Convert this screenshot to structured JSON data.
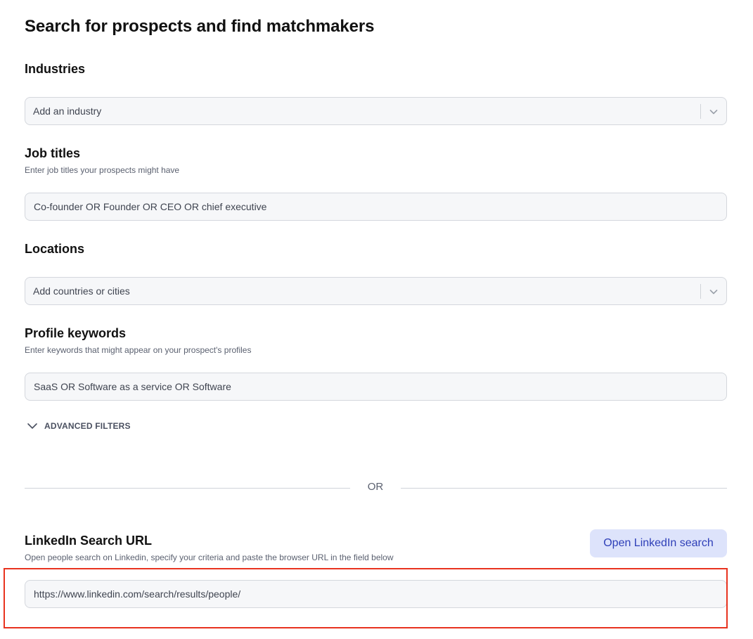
{
  "page": {
    "title": "Search for prospects and find matchmakers"
  },
  "industries": {
    "label": "Industries",
    "placeholder": "Add an industry"
  },
  "job_titles": {
    "label": "Job titles",
    "hint": "Enter job titles your prospects might have",
    "value": "Co-founder OR Founder OR CEO OR chief executive"
  },
  "locations": {
    "label": "Locations",
    "placeholder": "Add countries or cities"
  },
  "profile_keywords": {
    "label": "Profile keywords",
    "hint": "Enter keywords that might appear on your prospect's profiles",
    "value": "SaaS OR Software as a service OR Software"
  },
  "advanced_filters": {
    "label": "ADVANCED FILTERS"
  },
  "divider": {
    "label": "OR"
  },
  "linkedin": {
    "label": "LinkedIn Search URL",
    "hint": "Open people search on Linkedin, specify your criteria and paste the browser URL in the field below",
    "button_label": "Open LinkedIn search",
    "url_value": "https://www.linkedin.com/search/results/people/"
  },
  "colors": {
    "accent_button_bg": "#dde3fb",
    "accent_button_text": "#2e3fb8",
    "highlight": "#e8331f"
  }
}
